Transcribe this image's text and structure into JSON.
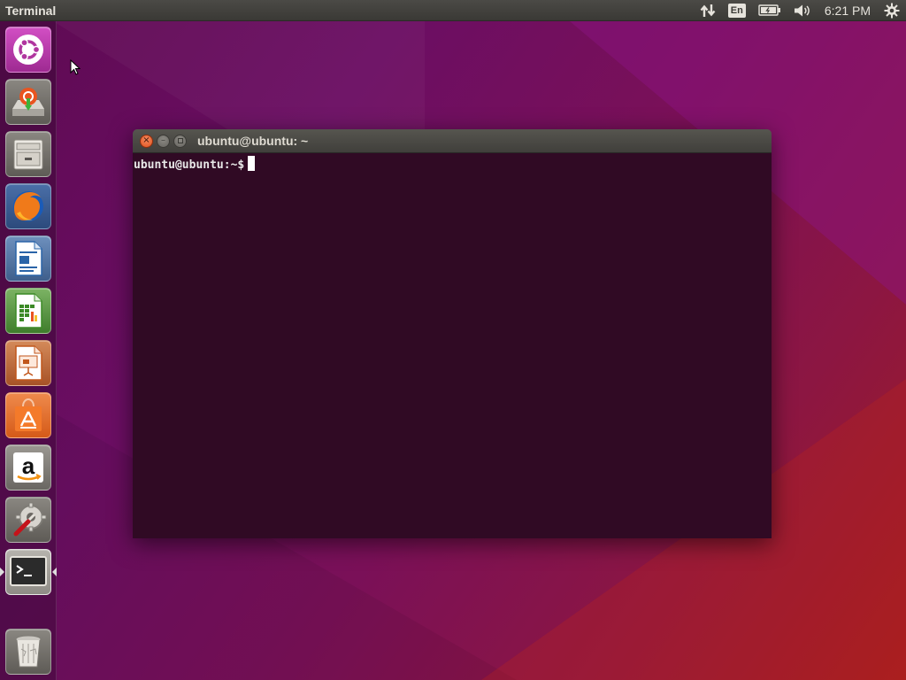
{
  "top_panel": {
    "app_title": "Terminal",
    "language": "En",
    "clock": "6:21 PM",
    "indicators": [
      "network-icon",
      "keyboard-language",
      "battery-icon",
      "volume-icon",
      "clock",
      "gear-icon"
    ]
  },
  "launcher": {
    "items": [
      {
        "name": "dash-home",
        "icon": "ubuntu-logo-icon"
      },
      {
        "name": "install-ubuntu",
        "icon": "installer-icon"
      },
      {
        "name": "files",
        "icon": "file-cabinet-icon"
      },
      {
        "name": "firefox",
        "icon": "firefox-icon"
      },
      {
        "name": "libreoffice-writer",
        "icon": "writer-icon"
      },
      {
        "name": "libreoffice-calc",
        "icon": "calc-icon"
      },
      {
        "name": "libreoffice-impress",
        "icon": "impress-icon"
      },
      {
        "name": "ubuntu-software",
        "icon": "software-bag-icon"
      },
      {
        "name": "amazon",
        "icon": "amazon-icon"
      },
      {
        "name": "system-settings",
        "icon": "settings-wrench-icon"
      },
      {
        "name": "terminal",
        "icon": "terminal-icon",
        "active": true
      },
      {
        "name": "trash",
        "icon": "trash-icon"
      }
    ]
  },
  "terminal": {
    "title": "ubuntu@ubuntu: ~",
    "prompt": "ubuntu@ubuntu:~$"
  },
  "colors": {
    "terminal_bg": "#300a24",
    "panel_bg": "#3c3b37",
    "close_button": "#e95420",
    "desktop_accent": "#77216f"
  }
}
